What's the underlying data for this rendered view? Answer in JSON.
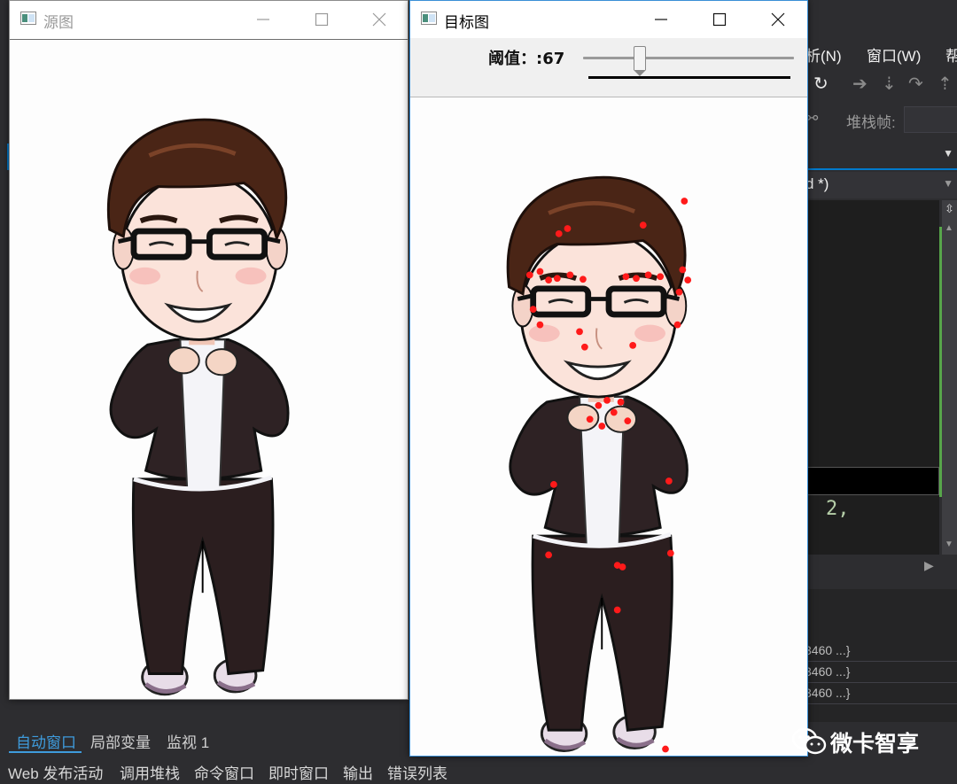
{
  "vs": {
    "menu": {
      "analyze": "析(N)",
      "window": "窗口(W)",
      "help": "帮"
    },
    "stack_frame_label": "堆栈帧:",
    "dropdown_text": "d *)",
    "code_snippet": "2,",
    "rows": [
      "3460 ...}",
      "3460 ...}",
      "3460 ...}"
    ],
    "bottom_tabs": [
      "自动窗口",
      "局部变量",
      "监视 1"
    ],
    "status_items": [
      "Web 发布活动",
      "调用堆栈",
      "命令窗口",
      "即时窗口",
      "输出",
      "错误列表"
    ],
    "accent": "#007acc"
  },
  "source_window": {
    "title": "源图"
  },
  "target_window": {
    "title": "目标图",
    "threshold_label": "阈值：:67",
    "threshold_value": 67,
    "threshold_max": 255
  },
  "watermark": {
    "text": "微卡智享"
  }
}
